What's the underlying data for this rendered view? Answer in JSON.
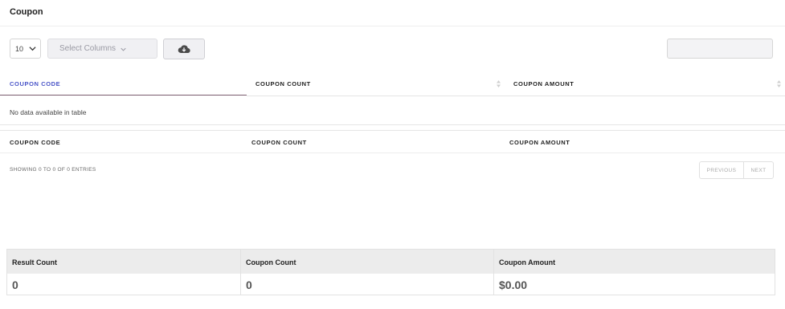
{
  "page": {
    "title": "Coupon"
  },
  "toolbar": {
    "page_length": "10",
    "column_select_label": "Select Columns",
    "download_icon": "cloud-download-icon",
    "search_value": ""
  },
  "table": {
    "headers": [
      "COUPON CODE",
      "COUPON COUNT",
      "COUPON AMOUNT"
    ],
    "empty_message": "No data available in table",
    "footers": [
      "COUPON CODE",
      "COUPON COUNT",
      "COUPON AMOUNT"
    ],
    "info": "SHOWING 0 TO 0 OF 0 ENTRIES",
    "pagination": {
      "previous": "PREVIOUS",
      "next": "NEXT"
    }
  },
  "summary": {
    "headers": [
      "Result Count",
      "Coupon Count",
      "Coupon Amount"
    ],
    "values": [
      "0",
      "0",
      "$0.00"
    ]
  },
  "colors": {
    "active_header": "#4a55c8",
    "summary_header_bg": "#ececec"
  }
}
